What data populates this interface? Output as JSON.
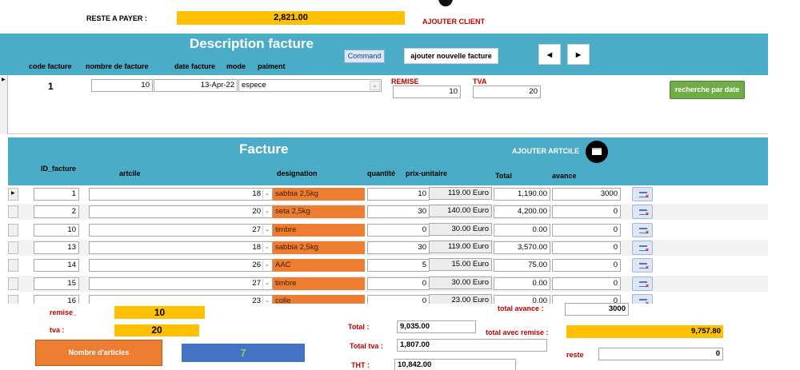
{
  "top": {
    "reste_label": "RESTE A PAYER :",
    "reste_value": "2,821.00",
    "ajouter_client": "AJOUTER CLIENT"
  },
  "description": {
    "title": "Description facture",
    "headers": {
      "code": "code facture",
      "nombre": "nombre de facture",
      "date": "date facture",
      "mode": "mode",
      "paiment": "paiment"
    },
    "command_button": "Command",
    "new_invoice_button": "ajouter nouvelle facture",
    "prev_icon": "arrow-left-icon",
    "next_icon": "arrow-right-icon",
    "code_value": "1",
    "nombre_value": "10",
    "date_value": "13-Apr-22",
    "mode_value": "espece",
    "remise_label": "REMISE",
    "remise_value": "10",
    "tva_label": "TVA",
    "tva_value": "20",
    "search_date_button": "recherche par date"
  },
  "facture": {
    "title": "Facture",
    "add_article": "AJOUTER ARTCILE",
    "headers": {
      "id": "ID_facture",
      "article": "artcile",
      "designation": "designation",
      "quantite": "quantité",
      "prix": "prix-unitaire",
      "total": "Total",
      "avance": "avance"
    },
    "rows": [
      {
        "id": "1",
        "article": "18",
        "designation": "sabbia 2,5kg",
        "quantite": "10",
        "prix": "119.00 Euro",
        "total": "1,190.00",
        "avance": "3000"
      },
      {
        "id": "2",
        "article": "20",
        "designation": "seta 2,5kg",
        "quantite": "30",
        "prix": "140.00 Euro",
        "total": "4,200.00",
        "avance": "0"
      },
      {
        "id": "10",
        "article": "27",
        "designation": "timbre",
        "quantite": "0",
        "prix": "30.00 Euro",
        "total": "0.00",
        "avance": "0"
      },
      {
        "id": "13",
        "article": "18",
        "designation": "sabbia 2,5kg",
        "quantite": "30",
        "prix": "119.00 Euro",
        "total": "3,570.00",
        "avance": "0"
      },
      {
        "id": "14",
        "article": "26",
        "designation": "AAC",
        "quantite": "5",
        "prix": "15.00 Euro",
        "total": "75.00",
        "avance": "0"
      },
      {
        "id": "15",
        "article": "27",
        "designation": "timbre",
        "quantite": "0",
        "prix": "30.00 Euro",
        "total": "0.00",
        "avance": "0"
      },
      {
        "id": "16",
        "article": "23",
        "designation": "colle",
        "quantite": "0",
        "prix": "23.00 Euro",
        "total": "0.00",
        "avance": "0"
      }
    ]
  },
  "summary": {
    "remise_label": "remise_",
    "remise_value": "10",
    "tva_label": "tva  :",
    "tva_value": "20",
    "nb_articles_label": "Nombre d'articles",
    "nb_articles_value": "7",
    "total_label": "Total :",
    "total_value": "9,035.00",
    "total_tva_label": "Total tva :",
    "total_tva_value": "1,807.00",
    "tht_label": "THT :",
    "tht_value": "10,842.00",
    "total_avance_label": "total avance :",
    "total_avance_value": "3000",
    "total_remise_label": "total avec remise :",
    "total_remise_value": "9,757.80",
    "reste_label": "reste",
    "reste_value": "0"
  },
  "colors": {
    "banner": "#4aacc6",
    "yellow": "#ffc000",
    "orange": "#ed7d31",
    "blue": "#4472c4",
    "green": "#70ad47",
    "red": "#c00000"
  }
}
